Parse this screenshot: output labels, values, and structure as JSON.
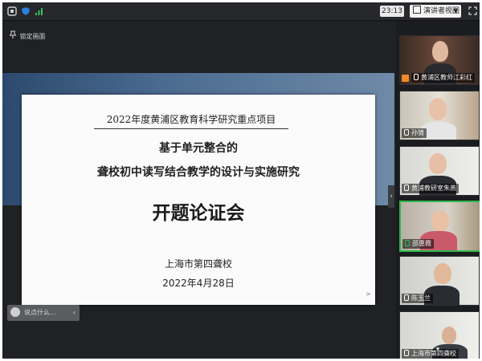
{
  "toolbar": {
    "timer": "23:13",
    "view_label": "演讲者视图",
    "icons": [
      "window-icon",
      "shield-icon",
      "signal-icon",
      "fullscreen-icon"
    ]
  },
  "share": {
    "lock_label": "锁定画面",
    "input_placeholder": "说点什么...",
    "collapse_icon": "chevron-right-icon"
  },
  "slide": {
    "subtitle": "2022年度黄浦区教育科学研究重点项目",
    "line1": "基于单元整合的",
    "line2": "聋校初中读写结合教学的设计与实施研究",
    "title": "开题论证会",
    "school": "上海市第四聋校",
    "date": "2022年4月28日",
    "next_glyph": ">"
  },
  "participants": [
    {
      "name": "黄浦区教师江彩红"
    },
    {
      "name": "孙猗"
    },
    {
      "name": "黄浦教研室朱燕"
    },
    {
      "name": "邵惠霞"
    },
    {
      "name": "陈玉兰"
    },
    {
      "name": "上海市第四聋校"
    }
  ],
  "colors": {
    "accent_active": "#2fb94a",
    "band": "#4a6a8f"
  }
}
